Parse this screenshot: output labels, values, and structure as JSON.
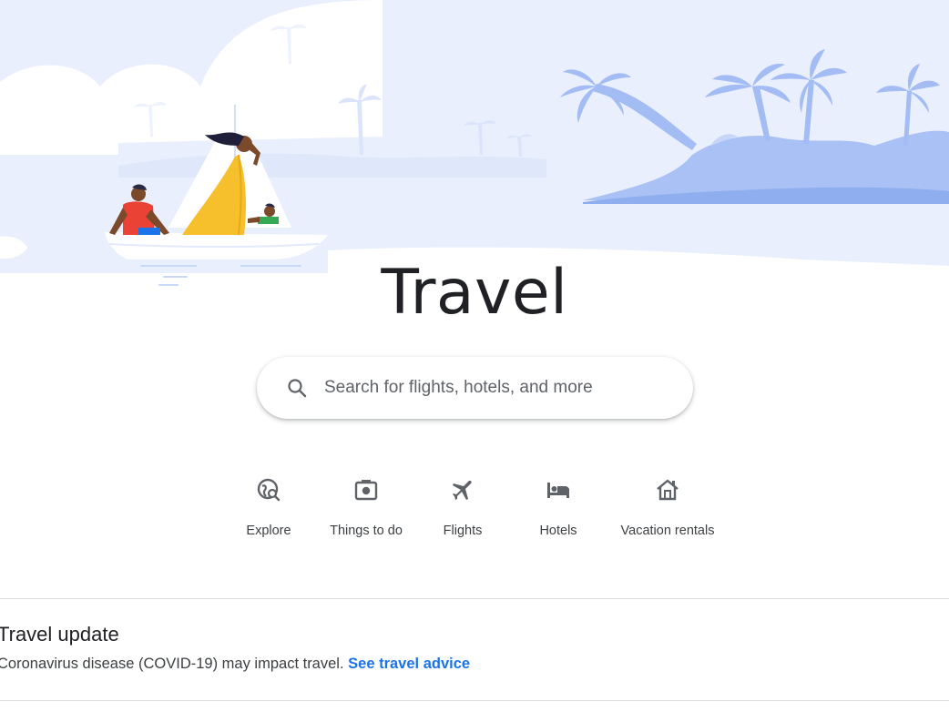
{
  "page": {
    "title": "Travel"
  },
  "search": {
    "placeholder": "Search for flights, hotels, and more",
    "icon": "search-icon"
  },
  "nav": {
    "items": [
      {
        "label": "Explore",
        "icon": "explore-globe-icon"
      },
      {
        "label": "Things to do",
        "icon": "camera-icon"
      },
      {
        "label": "Flights",
        "icon": "airplane-icon"
      },
      {
        "label": "Hotels",
        "icon": "bed-icon"
      },
      {
        "label": "Vacation rentals",
        "icon": "house-icon"
      }
    ]
  },
  "travel_update": {
    "heading": "Travel update",
    "message": "Coronavirus disease (COVID-19) may impact travel.",
    "link_text": "See travel advice"
  },
  "colors": {
    "text": "#202124",
    "link": "#1a73e8",
    "hero_sky": "#e8effd",
    "hero_island": "#9ab7f3",
    "icon": "#5f6368"
  }
}
